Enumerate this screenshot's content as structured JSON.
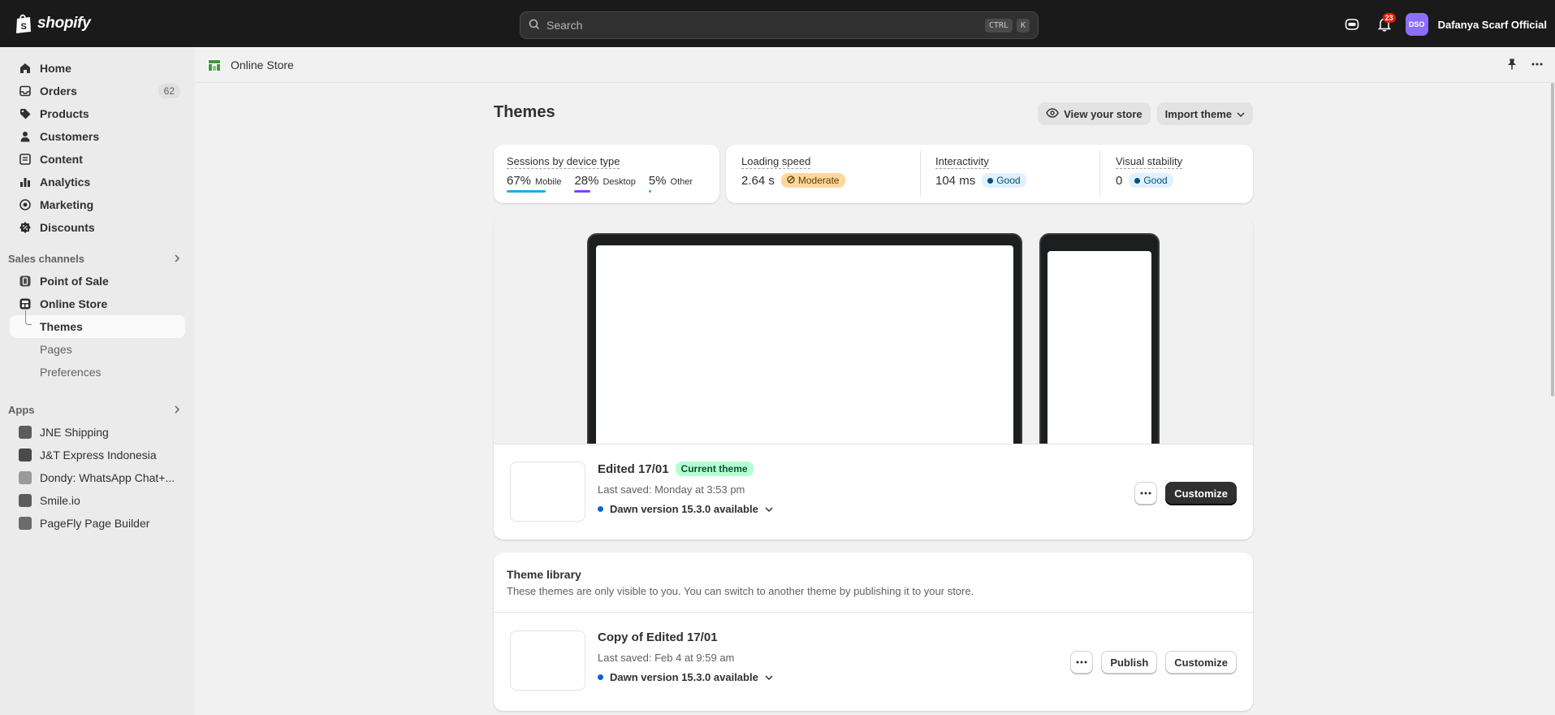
{
  "topbar": {
    "logo_text": "shopify",
    "search_placeholder": "Search",
    "shortcut_key1": "CTRL",
    "shortcut_key2": "K",
    "notification_count": "23",
    "avatar_initials": "DSO",
    "store_name": "Dafanya Scarf Official"
  },
  "sidebar": {
    "main_items": [
      {
        "label": "Home",
        "icon": "home-icon"
      },
      {
        "label": "Orders",
        "icon": "inbox-icon",
        "count": "62"
      },
      {
        "label": "Products",
        "icon": "tag-icon"
      },
      {
        "label": "Customers",
        "icon": "person-icon"
      },
      {
        "label": "Content",
        "icon": "content-icon"
      },
      {
        "label": "Analytics",
        "icon": "bar-chart-icon"
      },
      {
        "label": "Marketing",
        "icon": "target-icon"
      },
      {
        "label": "Discounts",
        "icon": "discount-icon"
      }
    ],
    "sales_channels_label": "Sales channels",
    "channels": [
      {
        "label": "Point of Sale",
        "icon": "pos-icon"
      },
      {
        "label": "Online Store",
        "icon": "store-icon"
      }
    ],
    "online_store_sub": [
      "Themes",
      "Pages",
      "Preferences"
    ],
    "apps_label": "Apps",
    "apps": [
      {
        "label": "JNE Shipping"
      },
      {
        "label": "J&T Express Indonesia"
      },
      {
        "label": "Dondy: WhatsApp Chat+..."
      },
      {
        "label": "Smile.io"
      },
      {
        "label": "PageFly Page Builder"
      }
    ]
  },
  "pagebar": {
    "title": "Online Store"
  },
  "main": {
    "title": "Themes",
    "view_store_label": "View your store",
    "import_theme_label": "Import theme",
    "sessions": {
      "label": "Sessions by device type",
      "mobile_pct": "67%",
      "mobile_label": "Mobile",
      "mobile_value": 67,
      "desktop_pct": "28%",
      "desktop_label": "Desktop",
      "desktop_value": 28,
      "other_pct": "5%",
      "other_label": "Other",
      "other_value": 5
    },
    "loading": {
      "label": "Loading speed",
      "value": "2.64 s",
      "status": "Moderate"
    },
    "interactivity": {
      "label": "Interactivity",
      "value": "104 ms",
      "status": "Good"
    },
    "stability": {
      "label": "Visual stability",
      "value": "0",
      "status": "Good"
    },
    "current_theme": {
      "name": "Edited 17/01",
      "badge": "Current theme",
      "last_saved": "Last saved: Monday at 3:53 pm",
      "version": "Dawn version 15.3.0 available",
      "customize_label": "Customize"
    },
    "library": {
      "title": "Theme library",
      "description": "These themes are only visible to you. You can switch to another theme by publishing it to your store.",
      "themes": [
        {
          "name": "Copy of Edited 17/01",
          "last_saved": "Last saved: Feb 4 at 9:59 am",
          "version": "Dawn version 15.3.0 available",
          "publish_label": "Publish",
          "customize_label": "Customize"
        }
      ]
    }
  },
  "colors": {
    "mobile_bar": "#2ba8e0",
    "desktop_bar": "#7b47f1",
    "other_bar": "#2ba8e0",
    "version_dot": "#0a63d7"
  }
}
